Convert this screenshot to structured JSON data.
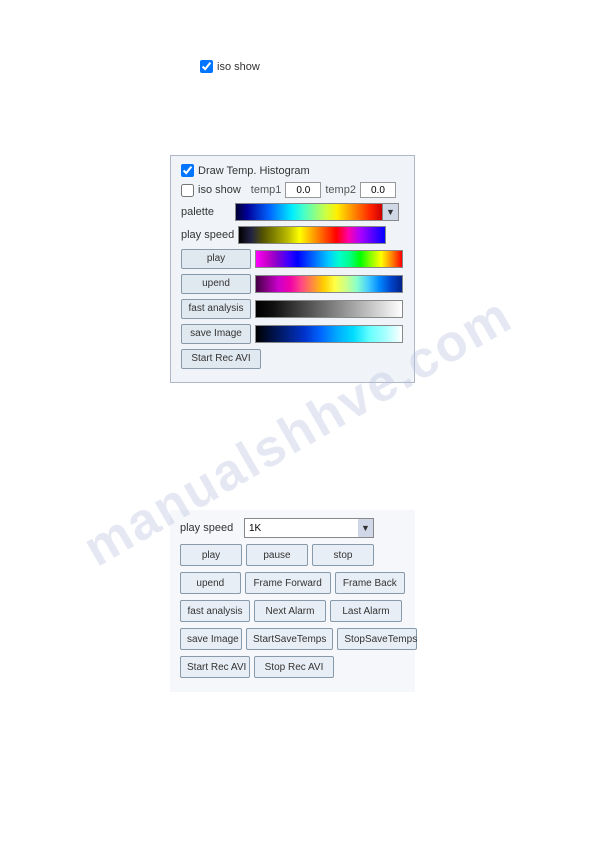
{
  "watermark": {
    "text": "manualshhve.com"
  },
  "top_iso": {
    "label": "iso show",
    "checked": true
  },
  "upper_panel": {
    "draw_histogram_label": "Draw Temp. Histogram",
    "iso_show_label": "iso show",
    "temp1_label": "temp1",
    "temp1_value": "0.0",
    "temp2_label": "temp2",
    "temp2_value": "0.0",
    "palette_label": "palette",
    "play_speed_label": "play speed",
    "buttons": {
      "play": "play",
      "upend": "upend",
      "fast_analysis": "fast analysis",
      "save_image": "save Image",
      "start_rec_avi": "Start Rec AVI"
    }
  },
  "lower_panel": {
    "play_speed_label": "play speed",
    "play_speed_value": "1K",
    "buttons": {
      "play": "play",
      "pause": "pause",
      "stop": "stop",
      "upend": "upend",
      "frame_forward": "Frame Forward",
      "frame_back": "Frame Back",
      "fast_analysis": "fast analysis",
      "next_alarm": "Next Alarm",
      "last_alarm": "Last Alarm",
      "save_image": "save Image",
      "start_save_temps": "StartSaveTemps",
      "stop_save_temps": "StopSaveTemps",
      "start_rec_avi": "Start Rec AVI",
      "stop_rec_avi": "Stop Rec AVI"
    }
  }
}
